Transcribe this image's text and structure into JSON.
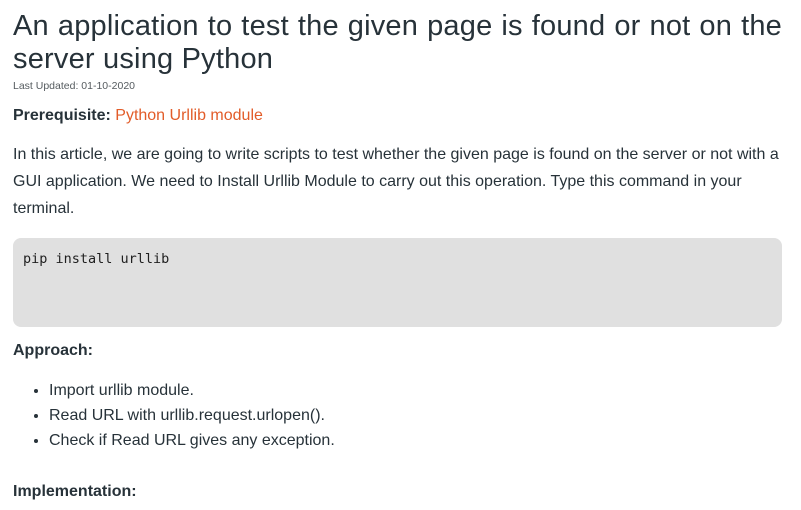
{
  "article": {
    "title": "An application to test the given page is found or not on the server using Python",
    "last_updated": "Last Updated: 01-10-2020",
    "prerequisite_label": "Prerequisite:",
    "prerequisite_link": "Python Urllib module",
    "intro": "In this article, we are going to write scripts to test whether the given page is found on the server or not with a GUI application. We need to Install Urllib Module to carry out this operation. Type this command in your terminal.",
    "code": "pip install urllib",
    "approach_heading": "Approach:",
    "steps": [
      "Import urllib module.",
      "Read URL with urllib.request.urlopen().",
      "Check if Read URL gives any exception."
    ],
    "implementation_heading": "Implementation:"
  },
  "colors": {
    "text": "#273239",
    "link": "#e25c29",
    "code_background": "#e0e0e0"
  }
}
